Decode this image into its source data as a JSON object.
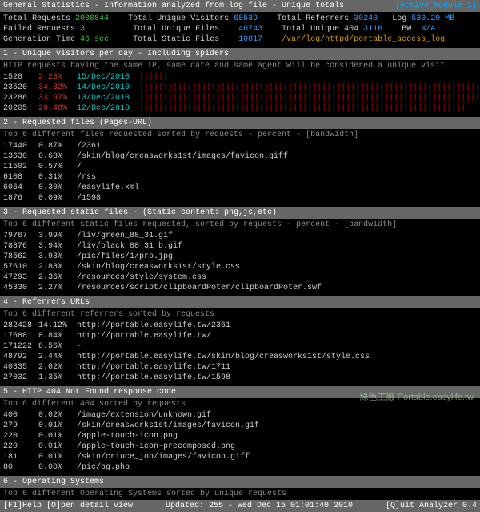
{
  "header": {
    "title": "General Statistics - Information analyzed from log file - Unique totals",
    "active_module": "[Active Module 1]"
  },
  "general": {
    "r1a_lbl": "Total Requests",
    "r1a_val": "2000844",
    "r1b_lbl": "Total Unique Visitors",
    "r1b_val": "68539",
    "r1c_lbl": "Total Referrers",
    "r1c_val": "30240",
    "r1d_lbl": "Log",
    "r1d_val": "530.29 MB",
    "r2a_lbl": "Failed Requests",
    "r2a_val": "3",
    "r2b_lbl": "Total Unique Files",
    "r2b_val": "40743",
    "r2c_lbl": "Total Unique 404",
    "r2c_val": "3116",
    "r2d_lbl": "BW",
    "r2d_val": "N/A",
    "r3a_lbl": "Generation Time",
    "r3a_val": "46 sec",
    "r3b_lbl": "Total Static Files",
    "r3b_val": "10817",
    "r3c_path": "/var/log/httpd/portable_access_log"
  },
  "s1": {
    "head": "1 - Unique visitors per day - Including spiders",
    "sub": "HTTP requests having the same IP, same date and same agent will be considered a unique visit",
    "rows": [
      {
        "hits": "1528",
        "pct": "2.23%",
        "date": "15/Dec/2010",
        "bar": "||||||"
      },
      {
        "hits": "23520",
        "pct": "34.32%",
        "date": "14/Dec/2010",
        "bar": "|||||||||||||||||||||||||||||||||||||||||||||||||||||||||||||||||||||||||||||||"
      },
      {
        "hits": "23286",
        "pct": "33.97%",
        "date": "13/Dec/2010",
        "bar": "|||||||||||||||||||||||||||||||||||||||||||||||||||||||||||||||||||||||||||||||"
      },
      {
        "hits": "20205",
        "pct": "29.48%",
        "date": "12/Dec/2010",
        "bar": "||||||||||||||||||||||||||||||||||||||||||||||||||||||||||||||||||||"
      }
    ]
  },
  "s2": {
    "head": "2 - Requested files (Pages-URL)",
    "sub": "Top 6 different files requested sorted by requests - percent - [bandwidth]",
    "rows": [
      {
        "hits": "17440",
        "pct": "0.87%",
        "path": "/2361"
      },
      {
        "hits": "13630",
        "pct": "0.68%",
        "path": "/skin/blog/creasworks1st/images/favicon.giff"
      },
      {
        "hits": "11502",
        "pct": "0.57%",
        "path": "/"
      },
      {
        "hits": "6108",
        "pct": "0.31%",
        "path": "/rss"
      },
      {
        "hits": "6064",
        "pct": "0.30%",
        "path": "/easylife.xml"
      },
      {
        "hits": "1876",
        "pct": "0.09%",
        "path": "/1598"
      }
    ]
  },
  "s3": {
    "head": "3 - Requested static files - (Static content: png,js,etc)",
    "sub": "Top 6 different static files requested, sorted by requests - percent - [bandwidth]",
    "rows": [
      {
        "hits": "79767",
        "pct": "3.99%",
        "path": "/liv/green_88_31.gif"
      },
      {
        "hits": "78876",
        "pct": "3.94%",
        "path": "/liv/black_88_31_b.gif"
      },
      {
        "hits": "78562",
        "pct": "3.93%",
        "path": "/pic/files/1/pro.jpg"
      },
      {
        "hits": "57610",
        "pct": "2.88%",
        "path": "/skin/blog/creasworks1st/style.css"
      },
      {
        "hits": "47293",
        "pct": "2.36%",
        "path": "/resources/style/system.css"
      },
      {
        "hits": "45330",
        "pct": "2.27%",
        "path": "/resources/script/clipboardPoter/clipboardPoter.swf"
      }
    ]
  },
  "s4": {
    "head": "4 - Referrers URLs",
    "sub": "Top 6 different referrers sorted by requests",
    "rows": [
      {
        "hits": "282428",
        "pct": "14.12%",
        "path": "http://portable.easylife.tw/2361"
      },
      {
        "hits": "176881",
        "pct": "8.84%",
        "path": "http://portable.easylife.tw/"
      },
      {
        "hits": "171222",
        "pct": "8.56%",
        "path": "-"
      },
      {
        "hits": "48792",
        "pct": "2.44%",
        "path": "http://portable.easylife.tw/skin/blog/creasworks1st/style.css"
      },
      {
        "hits": "40335",
        "pct": "2.02%",
        "path": "http://portable.easylife.tw/1711"
      },
      {
        "hits": "27032",
        "pct": "1.35%",
        "path": "http://portable.easylife.tw/1598"
      }
    ]
  },
  "s5": {
    "head": "5 - HTTP 404 Not Found response code",
    "sub": "Top 6 different 404 sorted by requests",
    "rows": [
      {
        "hits": "400",
        "pct": "0.02%",
        "path": "/image/extension/unknown.gif"
      },
      {
        "hits": "279",
        "pct": "0.01%",
        "path": "/skin/creasworks1st/images/favicon.gif"
      },
      {
        "hits": "220",
        "pct": "0.01%",
        "path": "/apple-touch-icon.png"
      },
      {
        "hits": "220",
        "pct": "0.01%",
        "path": "/apple-touch-icon-precomposed.png"
      },
      {
        "hits": "181",
        "pct": "0.01%",
        "path": "/skin/criuce_job/images/favicon.giff"
      },
      {
        "hits": "80",
        "pct": "0.00%",
        "path": "/pic/bg.php"
      }
    ]
  },
  "s6": {
    "head": "6 - Operating Systems",
    "sub": "Top 6 different Operating Systems sorted by unique requests"
  },
  "footer": {
    "left": "[F1]Help  [O]pen detail view",
    "mid": "Updated: 255 - Wed Dec 15 01:01:40 2010",
    "right": "[Q]uit Analyzer 0.4"
  },
  "watermark": "綠色工廠 Portable.easylife.tw"
}
